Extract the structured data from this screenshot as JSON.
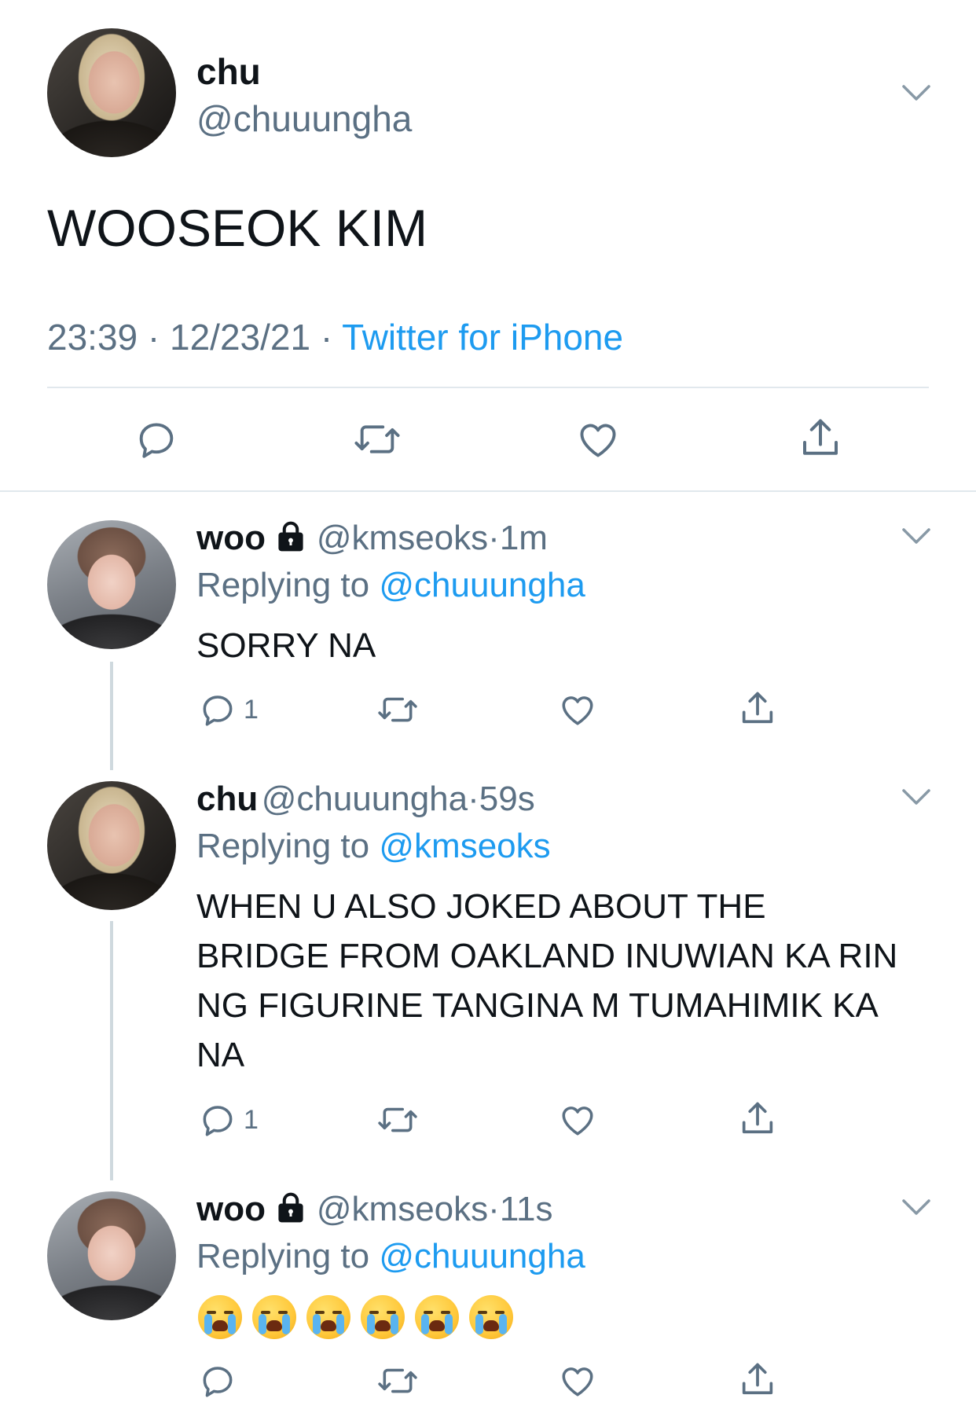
{
  "main_tweet": {
    "name": "chu",
    "handle": "@chuuungha",
    "text": "WOOSEOK KIM",
    "time": "23:39",
    "dot1": "·",
    "date": "12/23/21",
    "dot2": "·",
    "source": "Twitter for iPhone"
  },
  "replies": [
    {
      "name": "woo",
      "handle": "@kmseoks",
      "dot": "·",
      "time": "1m",
      "replying_prefix": "Replying to",
      "replying_to": "@chuuungha",
      "text": "SORRY NA",
      "reply_count": "1"
    },
    {
      "name": "chu",
      "handle": "@chuuungha",
      "dot": "·",
      "time": "59s",
      "replying_prefix": "Replying to",
      "replying_to": "@kmseoks",
      "text_lines": [
        "WHEN U ALSO JOKED ABOUT THE",
        "BRIDGE FROM OAKLAND INUWIAN KA RIN",
        "NG FIGURINE TANGINA M TUMAHIMIK KA",
        "NA"
      ],
      "reply_count": "1"
    },
    {
      "name": "woo",
      "handle": "@kmseoks",
      "dot": "·",
      "time": "11s",
      "replying_prefix": "Replying to",
      "replying_to": "@chuuungha",
      "emoji": "loudly-crying-face",
      "emoji_count": 6
    }
  ],
  "colors": {
    "link": "#1d9bf0",
    "secondary_text": "#5b7083",
    "divider": "#e1e8ed",
    "icon": "#5b7083"
  },
  "icons": [
    "chevron-down-icon",
    "reply-icon",
    "retweet-icon",
    "like-icon",
    "share-icon",
    "lock-icon"
  ]
}
